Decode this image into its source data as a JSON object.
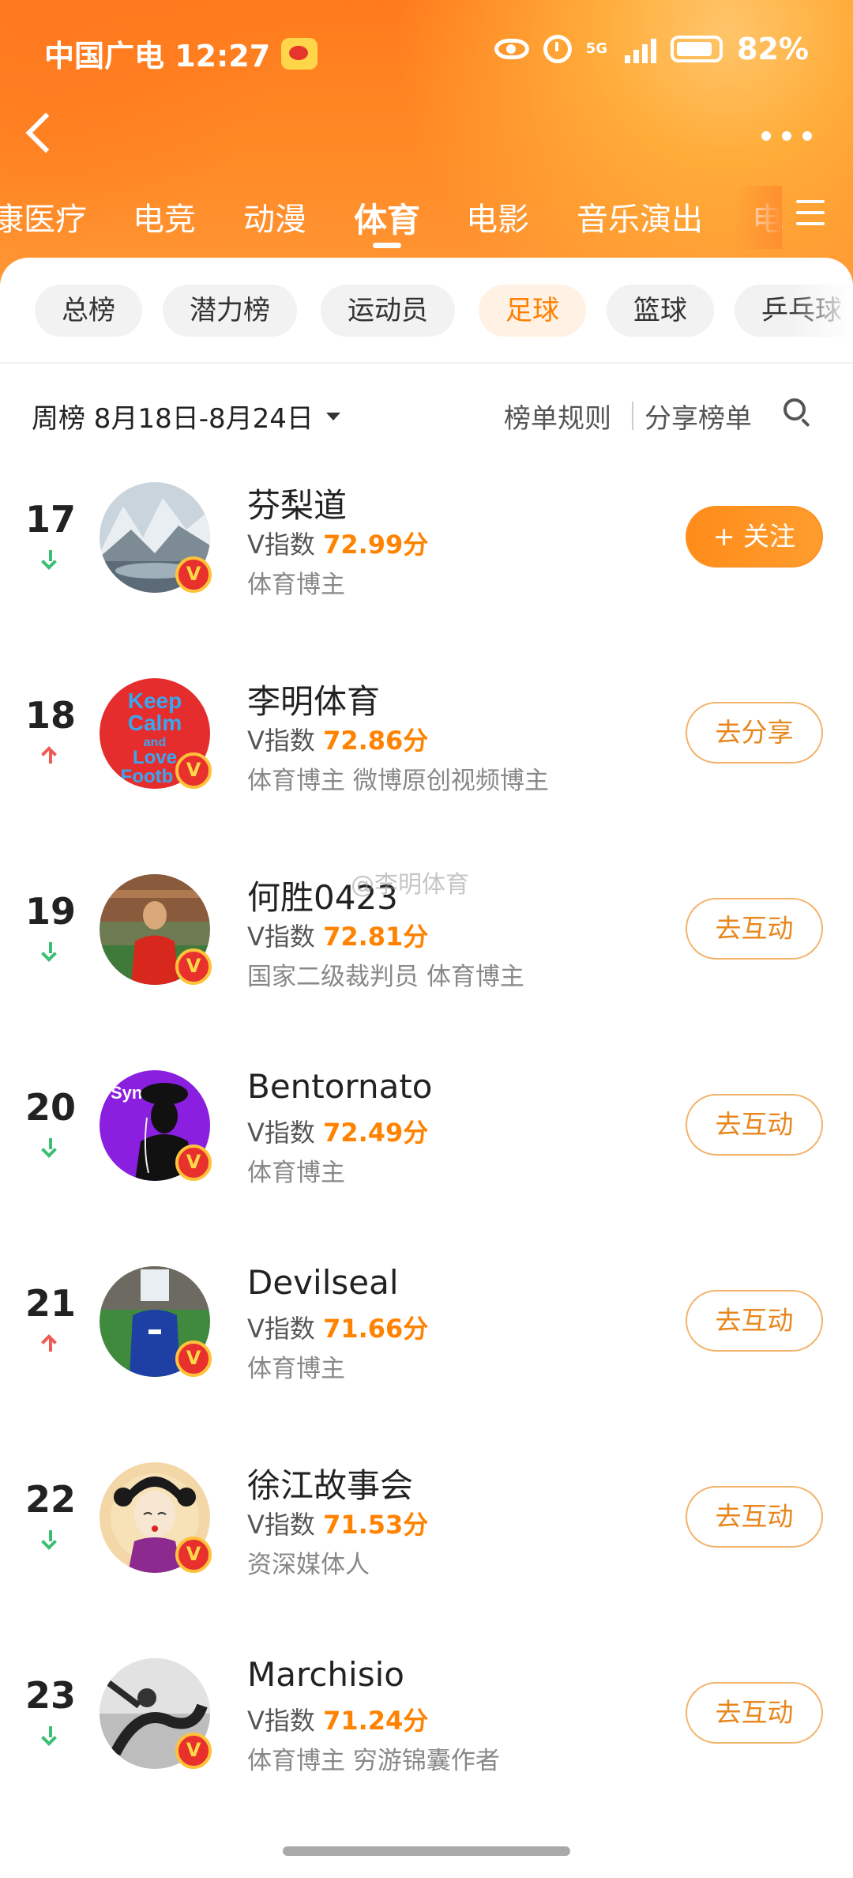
{
  "status_bar": {
    "carrier_time": "中国广电 12:27",
    "network": "5G",
    "battery": "82%"
  },
  "category_tabs": [
    "康医疗",
    "电竞",
    "动漫",
    "体育",
    "电影",
    "音乐演出",
    "电"
  ],
  "active_category": "体育",
  "chips": [
    "总榜",
    "潜力榜",
    "运动员",
    "足球",
    "篮球",
    "乒乓球"
  ],
  "active_chip": "足球",
  "period": {
    "label": "周榜 8月18日-8月24日",
    "rules": "榜单规则",
    "share": "分享榜单"
  },
  "v_prefix": "V指数",
  "watermark": "@李明体育",
  "rankings": [
    {
      "rank": "17",
      "trend": "down",
      "name": "芬梨道",
      "score": "72.99分",
      "tags": "体育博主",
      "action": "+ 关注",
      "action_type": "follow"
    },
    {
      "rank": "18",
      "trend": "up",
      "name": "李明体育",
      "score": "72.86分",
      "tags": "体育博主 微博原创视频博主",
      "action": "去分享",
      "action_type": "outline"
    },
    {
      "rank": "19",
      "trend": "down",
      "name": "何胜0423",
      "score": "72.81分",
      "tags": "国家二级裁判员 体育博主",
      "action": "去互动",
      "action_type": "outline"
    },
    {
      "rank": "20",
      "trend": "down",
      "name": "Bentornato",
      "score": "72.49分",
      "tags": "体育博主",
      "action": "去互动",
      "action_type": "outline"
    },
    {
      "rank": "21",
      "trend": "up",
      "name": "Devilseal",
      "score": "71.66分",
      "tags": "体育博主",
      "action": "去互动",
      "action_type": "outline"
    },
    {
      "rank": "22",
      "trend": "down",
      "name": "徐江故事会",
      "score": "71.53分",
      "tags": "资深媒体人",
      "action": "去互动",
      "action_type": "outline"
    },
    {
      "rank": "23",
      "trend": "down",
      "name": "Marchisio",
      "score": "71.24分",
      "tags": "体育博主 穷游锦囊作者",
      "action": "去互动",
      "action_type": "outline"
    }
  ],
  "avatar_texts": {
    "keep_calm": "Keep Calm and Love Football",
    "syn": "Syn"
  },
  "icons": {
    "back": "back-chevron-icon",
    "more": "more-dots-icon",
    "menu": "menu-icon",
    "search": "search-icon",
    "verified": "verified-v-icon",
    "trend_up": "trend-up-icon",
    "trend_down": "trend-down-icon"
  },
  "colors": {
    "accent": "#ff8200",
    "trend_up": "#ef5a55",
    "trend_down": "#3bbf72",
    "header": "#ff8a26"
  }
}
